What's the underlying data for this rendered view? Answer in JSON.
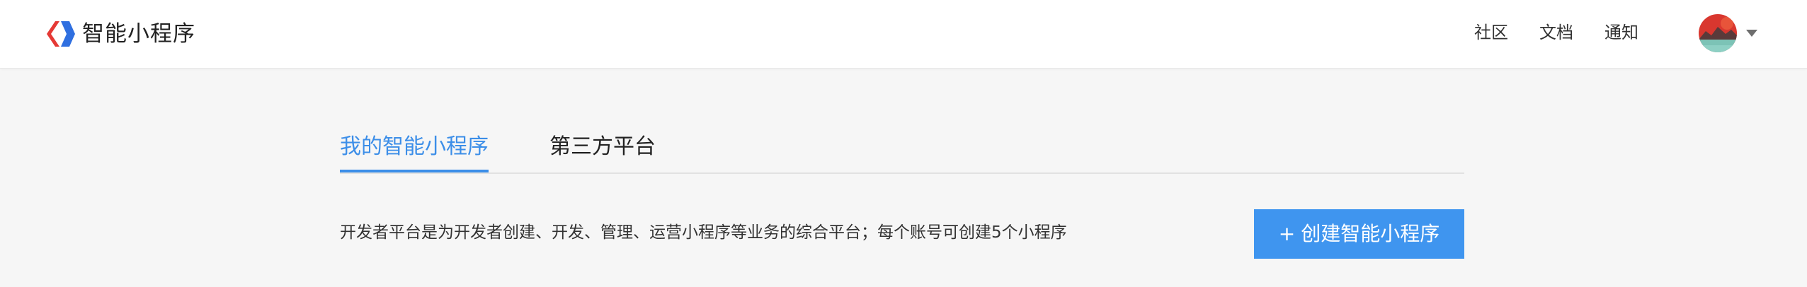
{
  "app": {
    "brand": "智能小程序",
    "logo_icon": "swan-logo-icon"
  },
  "header": {
    "nav": [
      "社区",
      "文档",
      "通知"
    ],
    "avatar_icon": "user-avatar",
    "dropdown_icon": "caret-down-icon"
  },
  "tabs": [
    {
      "label": "我的智能小程序",
      "active": true
    },
    {
      "label": "第三方平台",
      "active": false
    }
  ],
  "main": {
    "description": "开发者平台是为开发者创建、开发、管理、运营小程序等业务的综合平台；每个账号可创建5个小程序",
    "create_plus": "+",
    "create_label": "创建智能小程序"
  },
  "colors": {
    "accent": "#3c8ee8",
    "button": "#3f95ef",
    "background": "#f6f6f6",
    "header": "#ffffff"
  }
}
